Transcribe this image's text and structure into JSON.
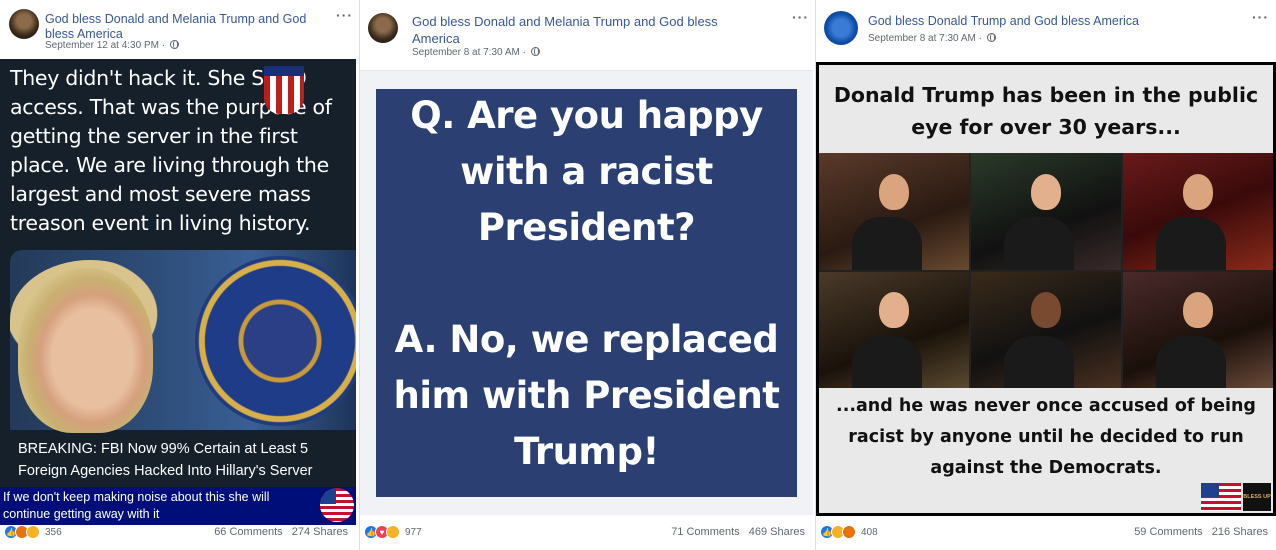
{
  "posts": [
    {
      "page_name": "God bless Donald and Melania Trump and God bless America",
      "meta": "September 12 at 4:30 PM · ",
      "tweet_text": "They didn't hack it. She SOLD access. That was the purpose of getting the server in the first place. We are living through the largest and most severe mass treason event in living history.",
      "news_title": "BREAKING: FBI Now 99% Certain at Least 5 Foreign Agencies Hacked Into Hillary's Server",
      "caption": "If we don't keep making noise about this she will continue getting away with it",
      "reaction_count": "356",
      "comments": "66 Comments",
      "shares": "274 Shares",
      "reactions": [
        "like",
        "angry",
        "wow"
      ]
    },
    {
      "page_name": "God bless Donald and Melania Trump and God bless America",
      "meta": "September 8 at 7:30 AM · ",
      "question": "Q. Are you happy with a racist President?",
      "answer": "A. No, we replaced him with President Trump!",
      "reaction_count": "977",
      "comments": "71 Comments",
      "shares": "469 Shares",
      "reactions": [
        "like",
        "love",
        "haha"
      ]
    },
    {
      "page_name": "God bless Donald Trump and God bless America",
      "meta": "September 8 at 7:30 AM · ",
      "meme_top": "Donald Trump has been in the public eye for over 30 years...",
      "meme_bottom": "...and he was never once accused of being racist by anyone until he decided to run against the Democrats.",
      "badge": "BLESS UP",
      "reaction_count": "408",
      "comments": "59 Comments",
      "shares": "216 Shares",
      "reactions": [
        "like",
        "sad",
        "angry"
      ]
    }
  ],
  "ui": {
    "more_label": "···",
    "icons": {
      "more": "more-options-icon",
      "globe": "globe-icon",
      "like": "like-reaction-icon",
      "love": "love-reaction-icon",
      "haha": "haha-reaction-icon",
      "wow": "wow-reaction-icon",
      "sad": "sad-reaction-icon",
      "angry": "angry-reaction-icon"
    }
  },
  "colors": {
    "link_blue": "#385898",
    "meta_grey": "#616770",
    "tweet_bg": "#15202b",
    "caption_bg": "#000e7a",
    "qa_card_bg": "#2c3f72"
  }
}
